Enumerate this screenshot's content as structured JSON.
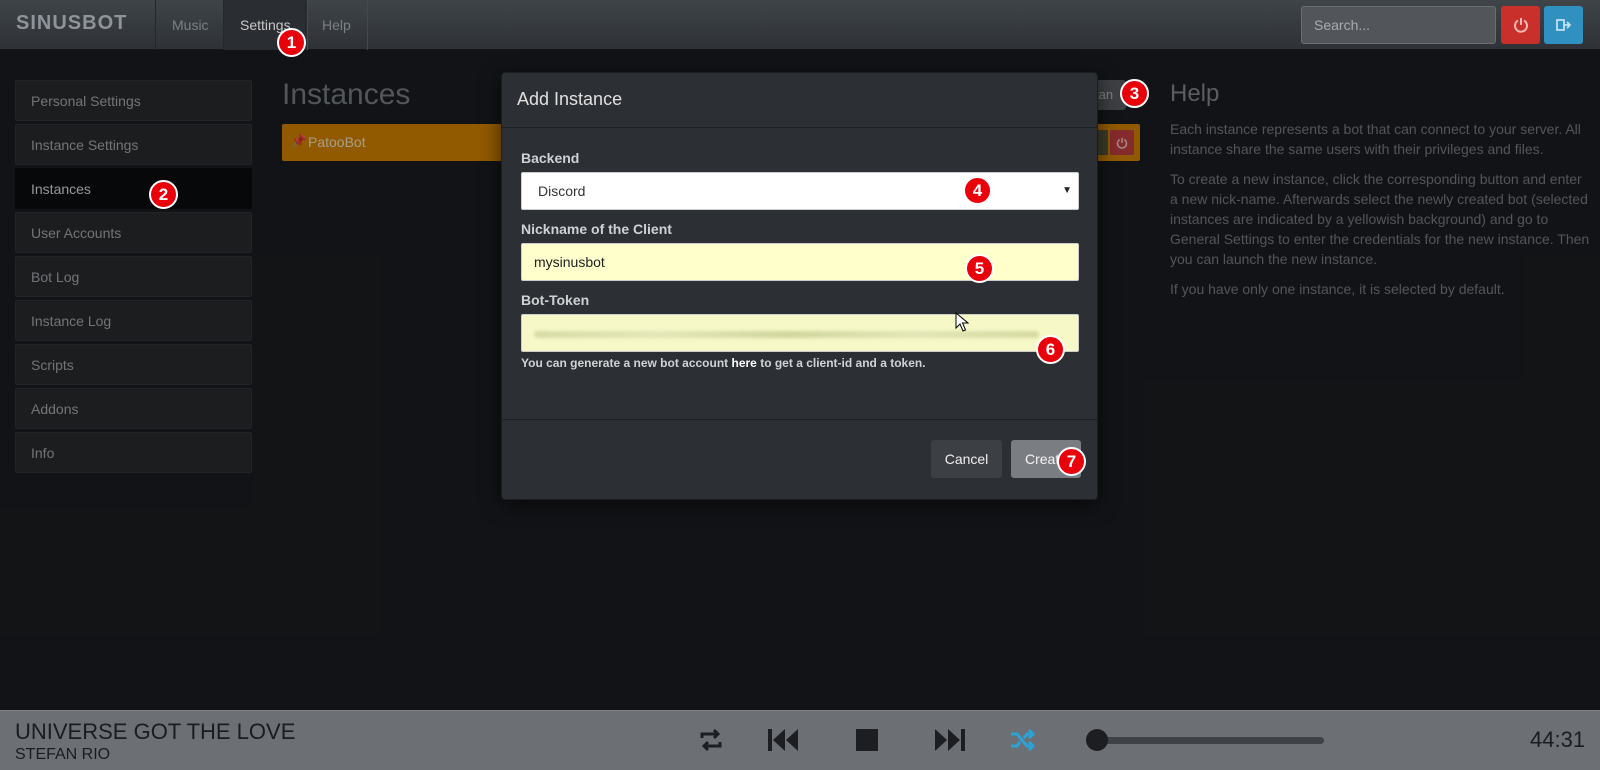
{
  "brand": "SINUSBOT",
  "nav": {
    "items": [
      {
        "label": "Music"
      },
      {
        "label": "Settings"
      },
      {
        "label": "Help"
      }
    ],
    "search_placeholder": "Search..."
  },
  "sidebar": {
    "items": [
      {
        "label": "Personal Settings"
      },
      {
        "label": "Instance Settings"
      },
      {
        "label": "Instances"
      },
      {
        "label": "User Accounts"
      },
      {
        "label": "Bot Log"
      },
      {
        "label": "Instance Log"
      },
      {
        "label": "Scripts"
      },
      {
        "label": "Addons"
      },
      {
        "label": "Info"
      }
    ],
    "active": "Instances"
  },
  "main": {
    "title": "Instances",
    "add_button_partial": "tan",
    "instances": [
      {
        "name": "PatooBot"
      }
    ]
  },
  "help": {
    "title": "Help",
    "paragraphs": [
      "Each instance represents a bot that can connect to your server. All instance share the same users with their privileges and files.",
      "To create a new instance, click the corresponding button and enter a new nick-name. Afterwards select the newly created bot (selected instances are indicated by a yellowish background) and go to General Settings to enter the credentials for the new instance. Then you can launch the new instance.",
      "If you have only one instance, it is selected by default."
    ]
  },
  "modal": {
    "title": "Add Instance",
    "backend_label": "Backend",
    "backend_value": "Discord",
    "nickname_label": "Nickname of the Client",
    "nickname_value": "mysinusbot",
    "token_label": "Bot-Token",
    "token_help_before": "You can generate a new bot account ",
    "token_help_link": "here",
    "token_help_after": " to get a client-id and a token.",
    "cancel_label": "Cancel",
    "create_label": "Create"
  },
  "steps": [
    "1",
    "2",
    "3",
    "4",
    "5",
    "6",
    "7"
  ],
  "player": {
    "title": "UNIVERSE GOT THE LOVE",
    "artist": "STEFAN RIO",
    "time": "44:31",
    "progress": 0.0
  },
  "colors": {
    "instance_row": "#e08a00",
    "badge": "#e8000b",
    "power": "#c9302c",
    "logout": "#3091c0"
  }
}
